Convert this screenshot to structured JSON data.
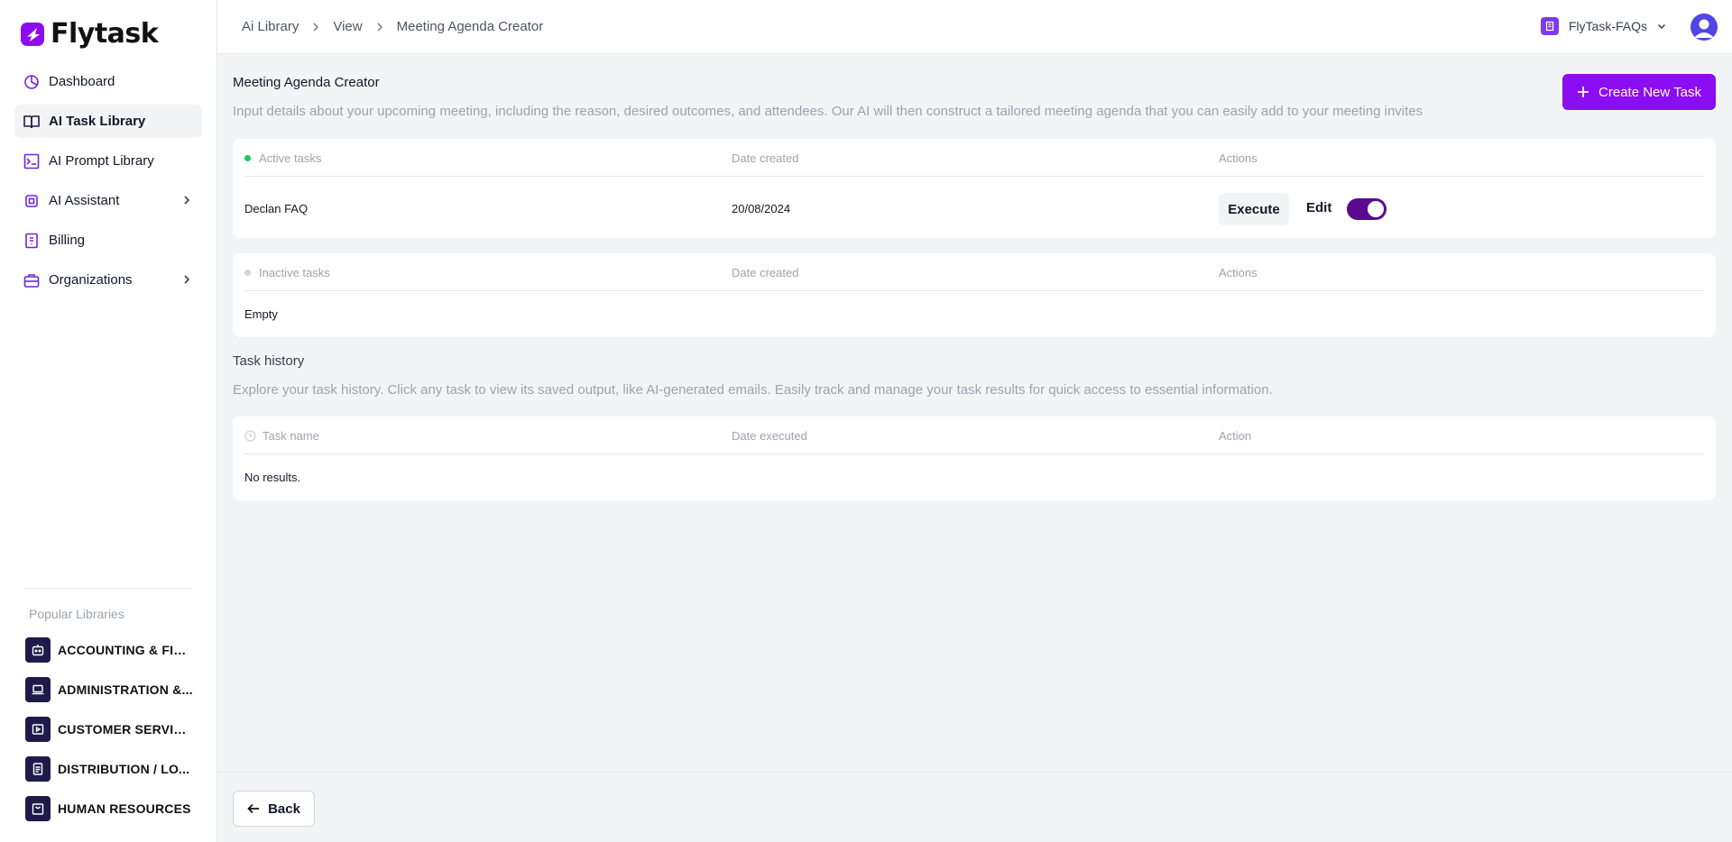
{
  "brand": {
    "name": "Flytask",
    "accent": "#8b0df2"
  },
  "sidebar": {
    "items": [
      {
        "label": "Dashboard",
        "icon": "dashboard-icon"
      },
      {
        "label": "AI Task Library",
        "icon": "book-icon"
      },
      {
        "label": "AI Prompt Library",
        "icon": "prompt-icon"
      },
      {
        "label": "AI Assistant",
        "icon": "cpu-icon"
      },
      {
        "label": "Billing",
        "icon": "receipt-icon"
      },
      {
        "label": "Organizations",
        "icon": "briefcase-icon"
      }
    ],
    "popular_title": "Popular Libraries",
    "libraries": [
      {
        "label": "ACCOUNTING & FIN...",
        "icon": "robot-icon"
      },
      {
        "label": "ADMINISTRATION &...",
        "icon": "laptop-icon"
      },
      {
        "label": "CUSTOMER SERVIC...",
        "icon": "presentation-icon"
      },
      {
        "label": "DISTRIBUTION / LO...",
        "icon": "clipboard-icon"
      },
      {
        "label": "HUMAN RESOURCES",
        "icon": "bag-icon"
      }
    ]
  },
  "header": {
    "breadcrumbs": [
      "Ai Library",
      "View",
      "Meeting Agenda Creator"
    ],
    "org_name": "FlyTask-FAQs"
  },
  "main": {
    "title": "Meeting Agenda Creator",
    "description": "Input details about your upcoming meeting, including the reason, desired outcomes, and attendees. Our AI will then construct a tailored meeting agenda that you can easily add to your meeting invites",
    "create_label": "Create New Task",
    "active": {
      "header": "Active tasks",
      "date_header": "Date created",
      "actions_header": "Actions",
      "rows": [
        {
          "name": "Declan FAQ",
          "date": "20/08/2024",
          "execute": "Execute",
          "edit": "Edit",
          "enabled": true
        }
      ]
    },
    "inactive": {
      "header": "Inactive tasks",
      "date_header": "Date created",
      "actions_header": "Actions",
      "empty": "Empty"
    },
    "history": {
      "title": "Task history",
      "description": "Explore your task history. Click any task to view its saved output, like AI-generated emails. Easily track and manage your task results for quick access to essential information.",
      "name_header": "Task name",
      "date_header": "Date executed",
      "action_header": "Action",
      "empty": "No results."
    }
  },
  "footer": {
    "back_label": "Back"
  }
}
